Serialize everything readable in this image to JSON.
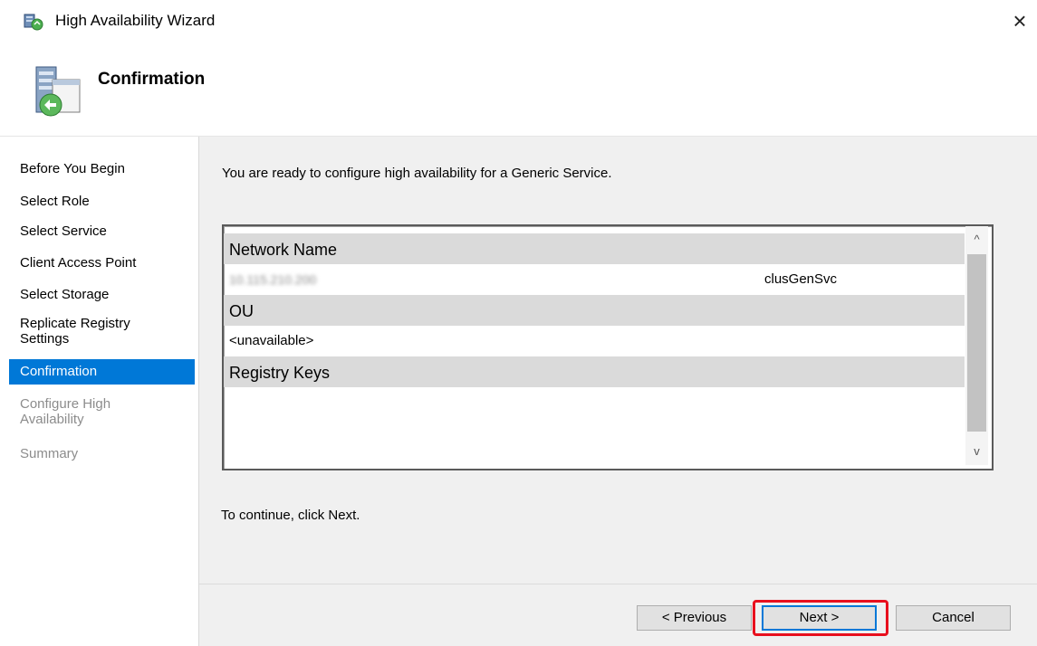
{
  "window": {
    "title": "High Availability Wizard",
    "close_glyph": "×"
  },
  "header": {
    "title": "Confirmation",
    "icon": "wizard-server-icon"
  },
  "nav": {
    "items": [
      {
        "label": "Before You Begin",
        "state": "normal"
      },
      {
        "label": "Select Role",
        "state": "normal"
      },
      {
        "label": "Select Service",
        "state": "normal"
      },
      {
        "label": "Client Access Point",
        "state": "normal"
      },
      {
        "label": "Select Storage",
        "state": "normal"
      },
      {
        "label": "Replicate Registry Settings",
        "state": "normal"
      },
      {
        "label": "Confirmation",
        "state": "selected"
      },
      {
        "label": "Configure High Availability",
        "state": "disabled"
      },
      {
        "label": "Summary",
        "state": "disabled"
      }
    ]
  },
  "content": {
    "intro": "You are ready to configure high availability for a Generic Service.",
    "continue": "To continue, click Next."
  },
  "summary_list": {
    "network_name_header": "Network Name",
    "network_ip": "10.115.210.200",
    "network_name_value": "clusGenSvc",
    "ou_header": "OU",
    "ou_value": "<unavailable>",
    "registry_header": "Registry Keys",
    "scroll_up": "^",
    "scroll_down": "v"
  },
  "buttons": {
    "previous": "< Previous",
    "next": "Next >",
    "cancel": "Cancel"
  },
  "colors": {
    "selection": "#0078d7",
    "highlight": "#e8101e"
  }
}
